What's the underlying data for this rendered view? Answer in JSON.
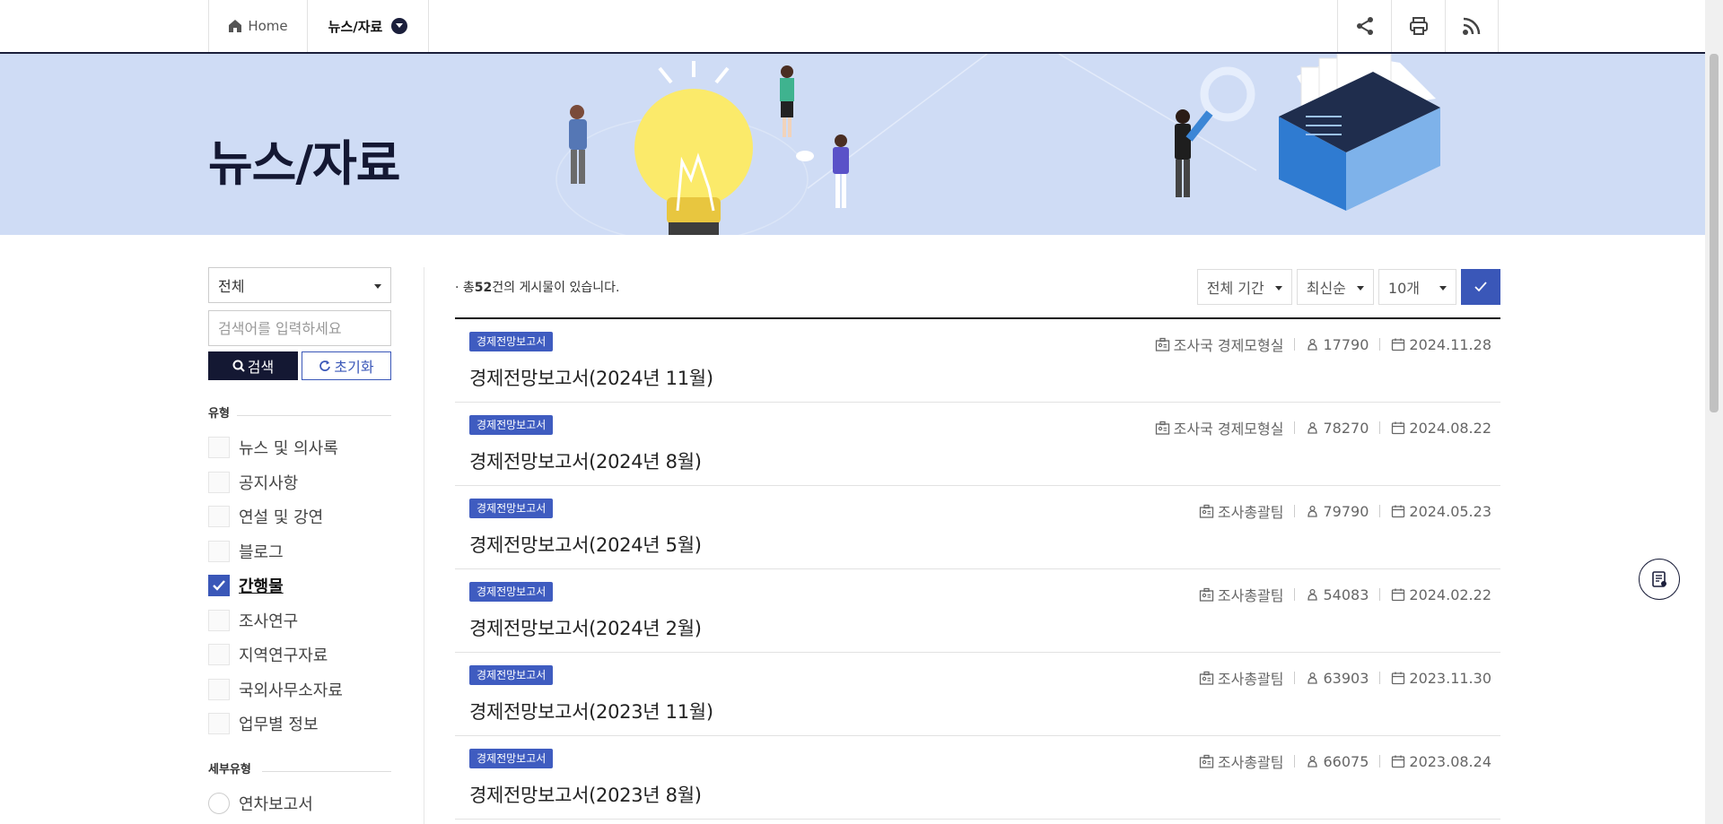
{
  "topbar": {
    "home_label": "Home",
    "current_label": "뉴스/자료",
    "tools": [
      "share-icon",
      "print-icon",
      "rss-icon"
    ]
  },
  "banner": {
    "title": "뉴스/자료"
  },
  "sidebar": {
    "scope_select": "전체",
    "search_placeholder": "검색어를 입력하세요",
    "search_button": "검색",
    "reset_button": "초기화",
    "type_label": "유형",
    "types": [
      {
        "label": "뉴스 및 의사록",
        "checked": false
      },
      {
        "label": "공지사항",
        "checked": false
      },
      {
        "label": "연설 및 강연",
        "checked": false
      },
      {
        "label": "블로그",
        "checked": false
      },
      {
        "label": "간행물",
        "checked": true
      },
      {
        "label": "조사연구",
        "checked": false
      },
      {
        "label": "지역연구자료",
        "checked": false
      },
      {
        "label": "국외사무소자료",
        "checked": false
      },
      {
        "label": "업무별 정보",
        "checked": false
      }
    ],
    "subtype_label": "세부유형",
    "subtypes": [
      {
        "label": "연차보고서"
      }
    ]
  },
  "main": {
    "count_prefix": "총",
    "count": "52",
    "count_suffix": "건의 게시물이 있습니다.",
    "filters": {
      "period": "전체 기간",
      "sort": "최신순",
      "page_size": "10개"
    },
    "posts": [
      {
        "tag": "경제전망보고서",
        "title": "경제전망보고서(2024년 11월)",
        "dept": "조사국 경제모형실",
        "views": "17790",
        "date": "2024.11.28"
      },
      {
        "tag": "경제전망보고서",
        "title": "경제전망보고서(2024년 8월)",
        "dept": "조사국 경제모형실",
        "views": "78270",
        "date": "2024.08.22"
      },
      {
        "tag": "경제전망보고서",
        "title": "경제전망보고서(2024년 5월)",
        "dept": "조사총괄팀",
        "views": "79790",
        "date": "2024.05.23"
      },
      {
        "tag": "경제전망보고서",
        "title": "경제전망보고서(2024년 2월)",
        "dept": "조사총괄팀",
        "views": "54083",
        "date": "2024.02.22"
      },
      {
        "tag": "경제전망보고서",
        "title": "경제전망보고서(2023년 11월)",
        "dept": "조사총괄팀",
        "views": "63903",
        "date": "2023.11.30"
      },
      {
        "tag": "경제전망보고서",
        "title": "경제전망보고서(2023년 8월)",
        "dept": "조사총괄팀",
        "views": "66075",
        "date": "2023.08.24"
      }
    ]
  },
  "colors": {
    "navy": "#141833",
    "accent": "#3a57b8",
    "banner_bg": "#cfdcf5",
    "tag_bg": "#3f5cc0"
  }
}
